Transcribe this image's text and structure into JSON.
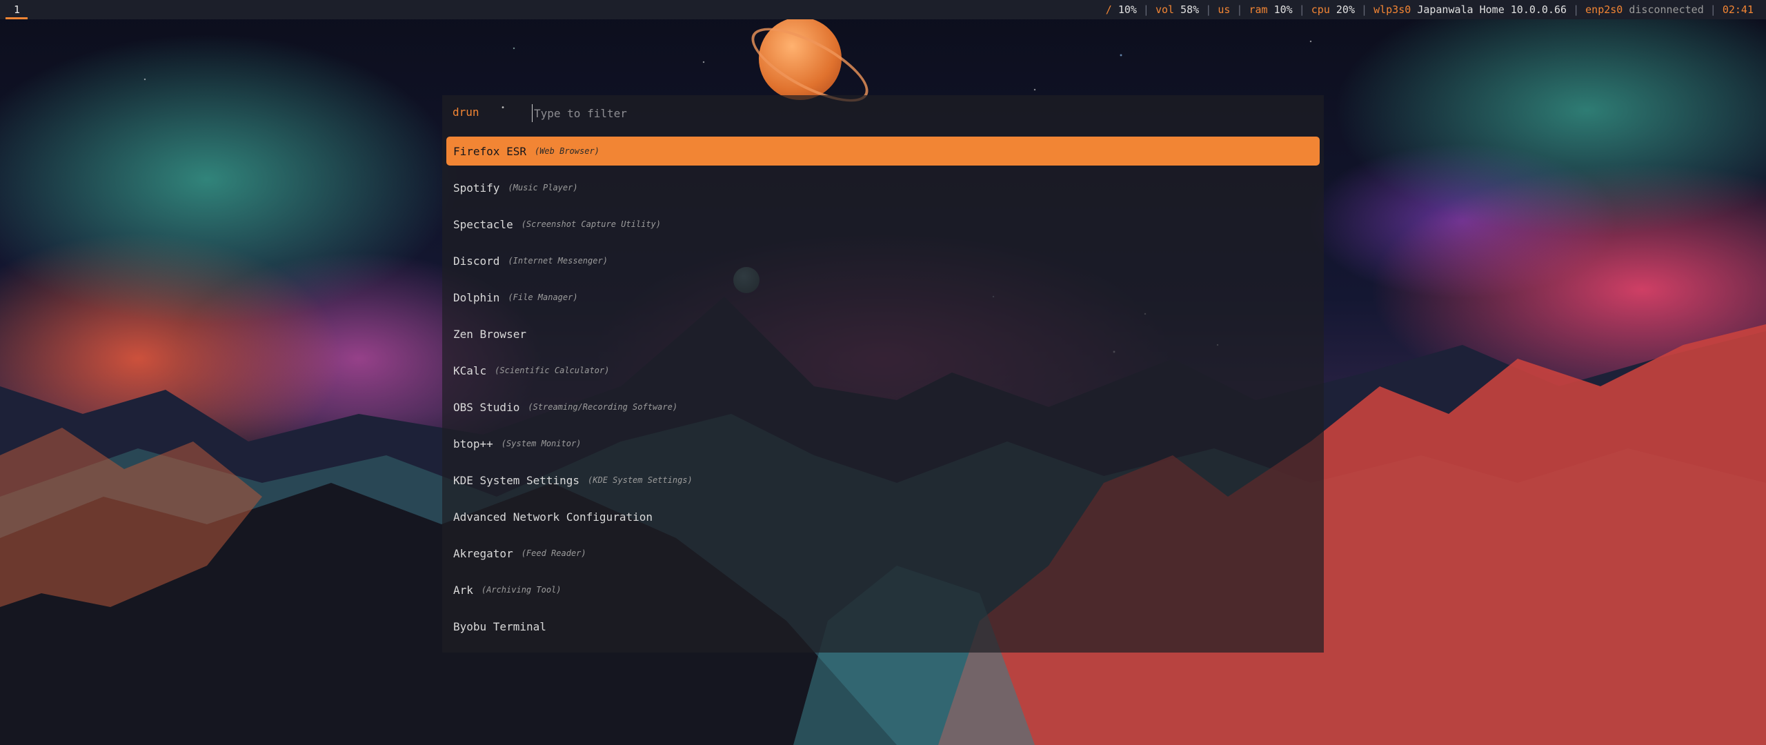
{
  "colors": {
    "accent": "#f28534",
    "bar_background": "#1c1f2a",
    "launcher_background": "rgba(30,30,36,0.70)",
    "text": "#dadada"
  },
  "topbar": {
    "workspace": "1",
    "status": [
      {
        "label": "/",
        "value": "10%"
      },
      {
        "label": "vol",
        "value": "58%"
      },
      {
        "label": "us",
        "value": ""
      },
      {
        "label": "ram",
        "value": "10%"
      },
      {
        "label": "cpu",
        "value": "20%"
      },
      {
        "label": "wlp3s0",
        "value": "Japanwala Home 10.0.0.66"
      },
      {
        "label": "enp2s0",
        "value": "disconnected"
      },
      {
        "label": "02:41",
        "value": ""
      }
    ]
  },
  "launcher": {
    "mode": "drun",
    "separator_icon": "prompt-separator-icon",
    "separator_glyph": "•",
    "placeholder": "Type to filter",
    "query": "",
    "selected_index": 0,
    "items": [
      {
        "name": "Firefox ESR",
        "generic": "(Web Browser)"
      },
      {
        "name": "Spotify",
        "generic": "(Music Player)"
      },
      {
        "name": "Spectacle",
        "generic": "(Screenshot Capture Utility)"
      },
      {
        "name": "Discord",
        "generic": "(Internet Messenger)"
      },
      {
        "name": "Dolphin",
        "generic": "(File Manager)"
      },
      {
        "name": "Zen Browser",
        "generic": ""
      },
      {
        "name": "KCalc",
        "generic": "(Scientific Calculator)"
      },
      {
        "name": "OBS Studio",
        "generic": "(Streaming/Recording Software)"
      },
      {
        "name": "btop++",
        "generic": "(System Monitor)"
      },
      {
        "name": "KDE System Settings",
        "generic": "(KDE System Settings)"
      },
      {
        "name": "Advanced Network Configuration",
        "generic": ""
      },
      {
        "name": "Akregator",
        "generic": "(Feed Reader)"
      },
      {
        "name": "Ark",
        "generic": "(Archiving Tool)"
      },
      {
        "name": "Byobu Terminal",
        "generic": ""
      }
    ]
  }
}
